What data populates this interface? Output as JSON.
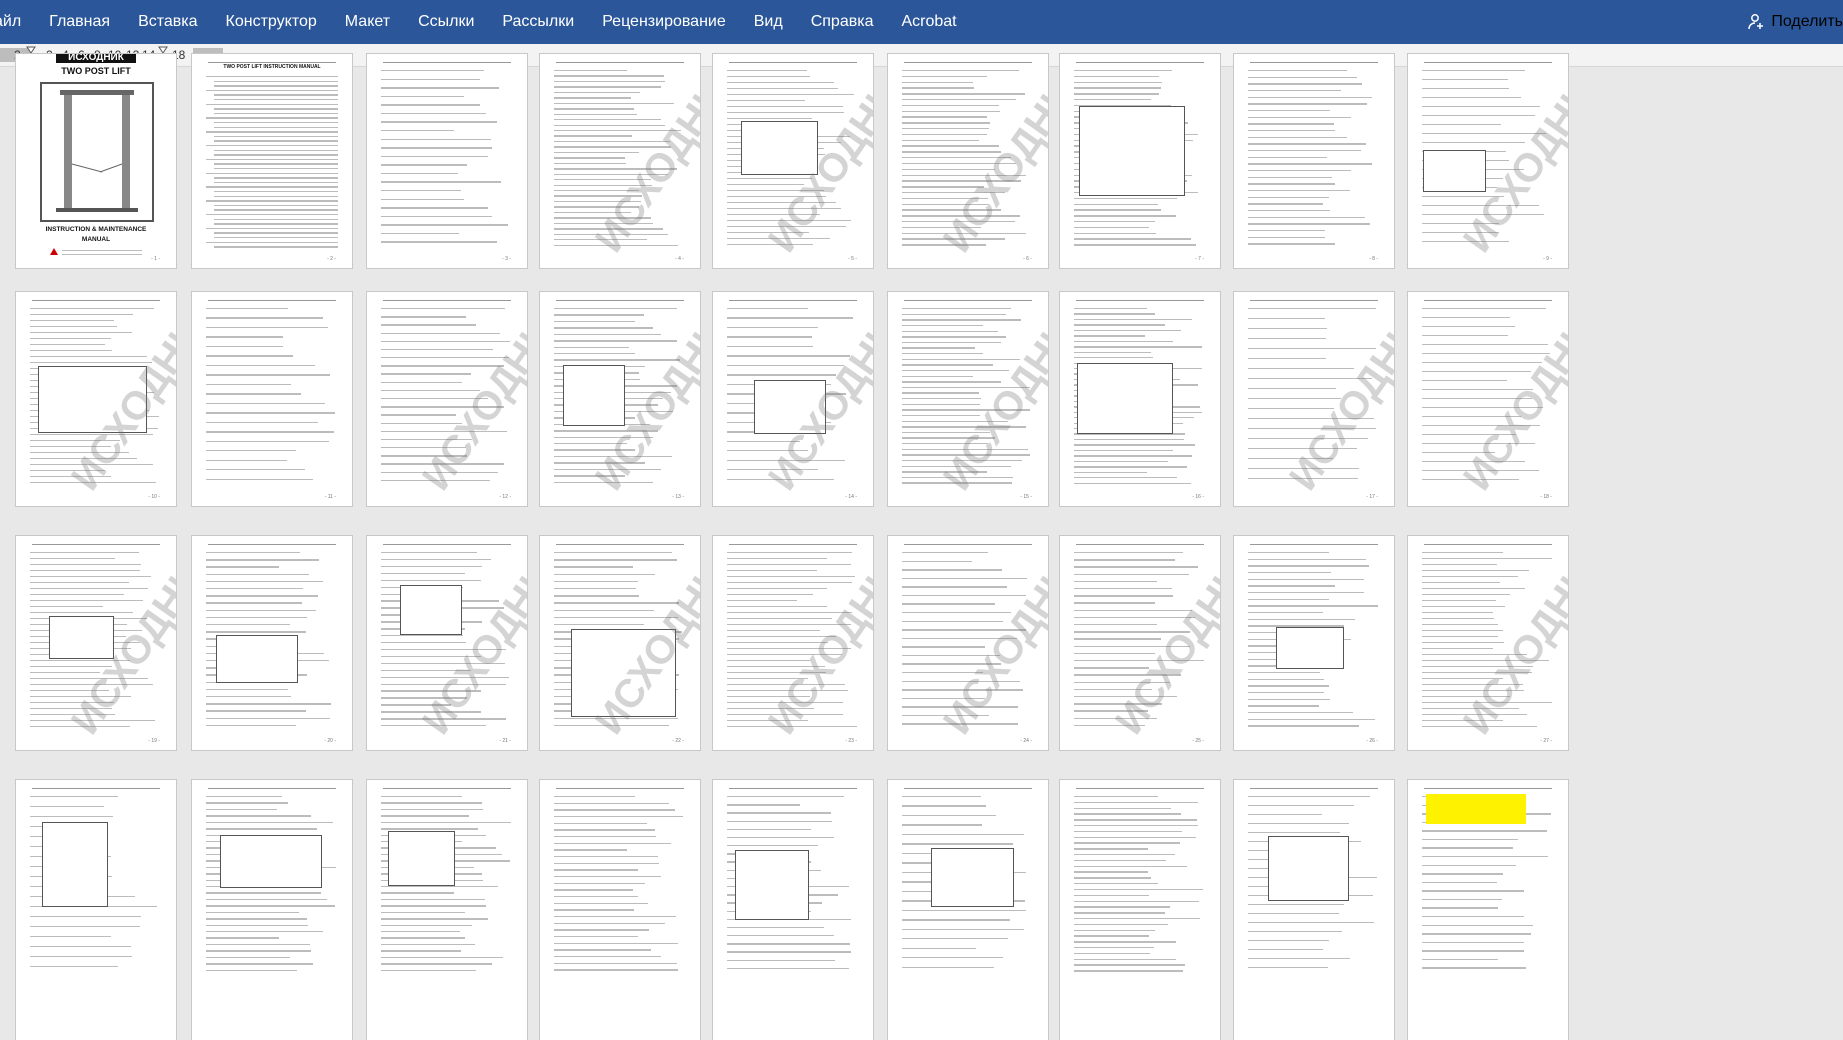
{
  "ribbon": {
    "tabs": [
      "айл",
      "Главная",
      "Вставка",
      "Конструктор",
      "Макет",
      "Ссылки",
      "Рассылки",
      "Рецензирование",
      "Вид",
      "Справка",
      "Acrobat"
    ],
    "share_label": "Поделить"
  },
  "ruler": {
    "numbers": [
      "2",
      "2",
      "4",
      "6",
      "8",
      "10",
      "12",
      "14",
      "18"
    ]
  },
  "cover": {
    "badge": "ИСХОДНИК",
    "title": "TWO POST LIFT",
    "subtitle1": "INSTRUCTION & MAINTENANCE",
    "subtitle2": "MANUAL"
  },
  "toc": {
    "title": "TWO POST LIFT INSTRUCTION MANUAL"
  },
  "watermark": "ИСХОДНИК",
  "headings": {
    "p2_3": "1. Packing, transport and storage",
    "p2_4": "2. Manual introduction",
    "p2_4b": "3. Description of the machine",
    "p3_1": "5. Machine structure and drive principle",
    "p3_2": "7. Installation",
    "p4_2": "Hydraulic oil hose diagram",
    "p4_3": "8. Commissioning",
    "p4_4": "9. Operation",
    "p4_7": "10. Maintenance and care",
    "p4_8": "11. Trouble shooting table",
    "p4_9": "12. Circuit diagram",
    "p5_1": "12. Explosion drawing"
  },
  "accent": {
    "ribbon_bg": "#2b579a",
    "ruler_bg": "#f3f3f3",
    "workspace_bg": "#e8e8e8",
    "highlight_yellow": "#fff200"
  }
}
